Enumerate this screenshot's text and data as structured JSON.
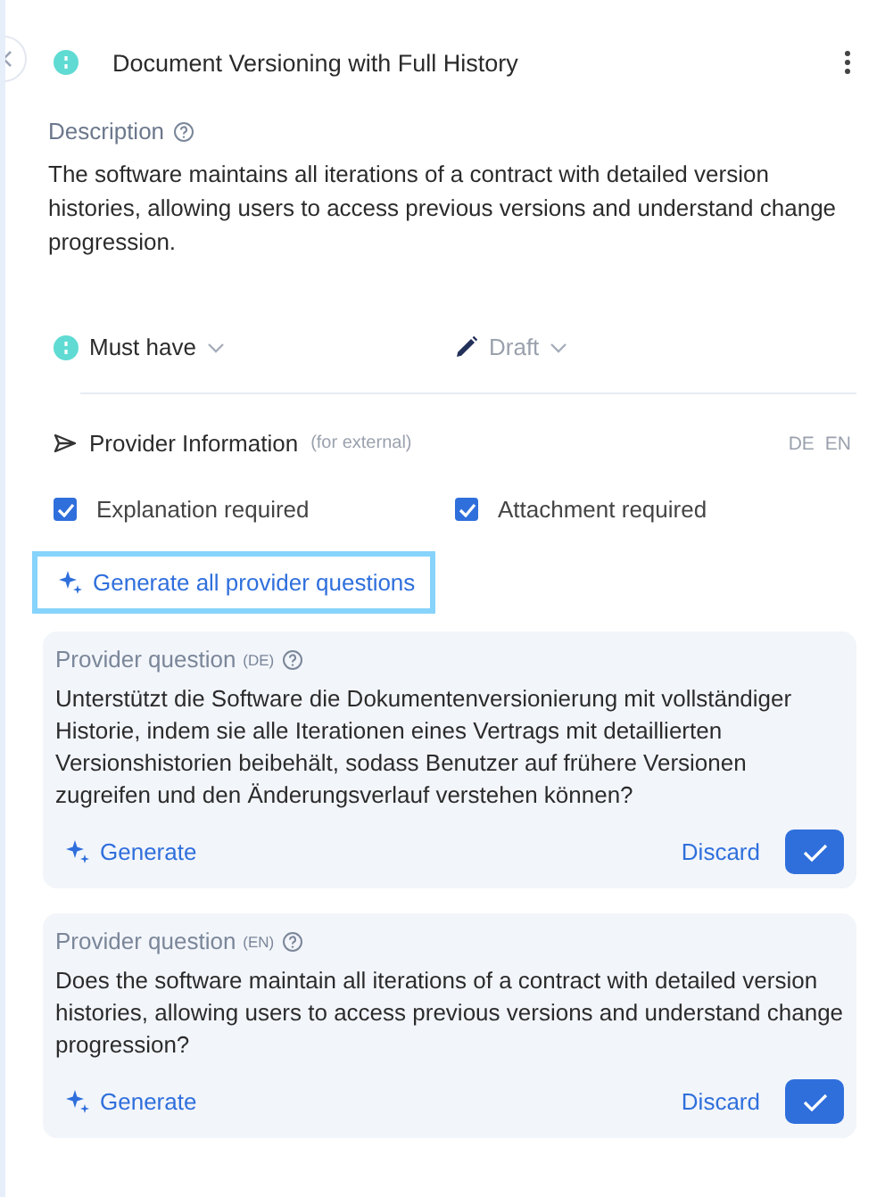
{
  "header": {
    "title": "Document Versioning with Full History"
  },
  "description": {
    "label": "Description",
    "text": "The software maintains all iterations of a contract with detailed version histories, allowing users to access previous versions and understand change progression."
  },
  "priority": {
    "label": "Must have"
  },
  "status": {
    "label": "Draft"
  },
  "provider_info": {
    "title": "Provider Information",
    "note": "(for external)",
    "languages": [
      "DE",
      "EN"
    ]
  },
  "checkboxes": [
    {
      "label": "Explanation required",
      "checked": true
    },
    {
      "label": "Attachment required",
      "checked": true
    }
  ],
  "generate_all": {
    "label": "Generate all provider questions",
    "focused": true
  },
  "questions": [
    {
      "label": "Provider question",
      "lang": "(DE)",
      "text": "Unterstützt die Software die Dokumentenversionierung mit vollständiger Historie, indem sie alle Iterationen eines Vertrags mit detaillierten Versionshistorien beibehält, sodass Benutzer auf frühere Versionen zugreifen und den Änderungsverlauf verstehen können?",
      "generate": "Generate",
      "discard": "Discard"
    },
    {
      "label": "Provider question",
      "lang": "(EN)",
      "text": "Does the software maintain all iterations of a contract with detailed version histories, allowing users to access previous versions and understand change progression?",
      "generate": "Generate",
      "discard": "Discard"
    }
  ]
}
